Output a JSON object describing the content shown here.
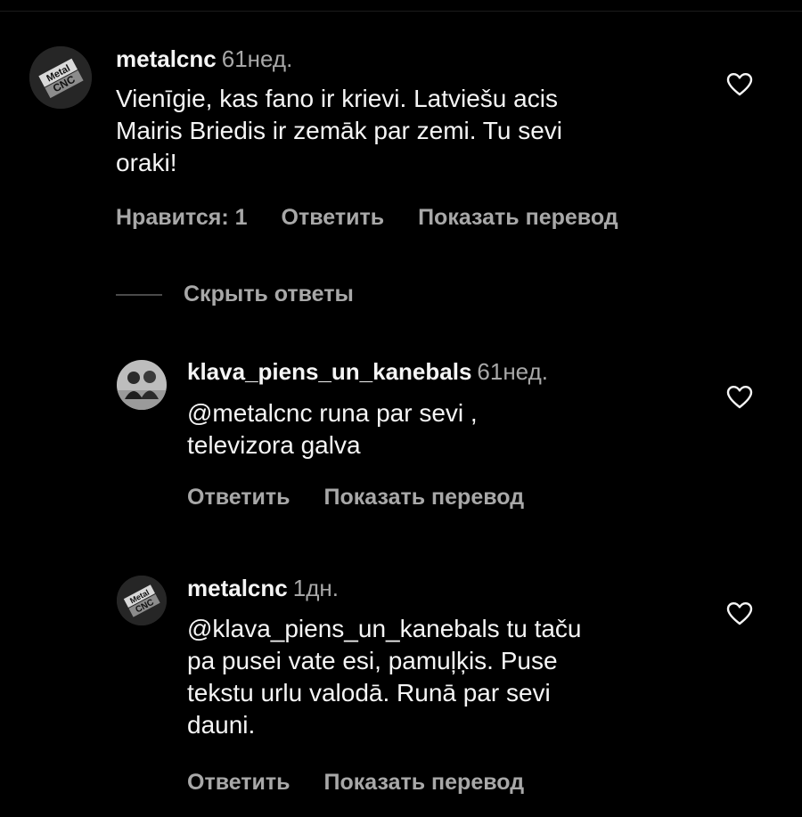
{
  "comments": [
    {
      "username": "metalcnc",
      "time": "61нед.",
      "text": "Vienīgie, kas fano ir krievi. Latviešu acis\nMairis Briedis ir zemāk par zemi. Tu sevi\noraki!",
      "likes_label": "Нравится: 1",
      "reply_label": "Ответить",
      "translate_label": "Показать перевод",
      "avatar_icon": "metal-cnc-logo"
    }
  ],
  "hide_replies_label": "Скрыть ответы",
  "replies": [
    {
      "username": "klava_piens_un_kanebals",
      "time": "61нед.",
      "text": "@metalcnc runa par sevi ,\ntelevizora galva",
      "reply_label": "Ответить",
      "translate_label": "Показать перевод",
      "avatar_icon": "two-people-photo"
    },
    {
      "username": "metalcnc",
      "time": "1дн.",
      "text": "@klava_piens_un_kanebals tu taču\npa pusei vate esi, pamuļķis. Puse\ntekstu urlu valodā. Runā par sevi\ndauni.",
      "reply_label": "Ответить",
      "translate_label": "Показать перевод",
      "avatar_icon": "metal-cnc-logo"
    }
  ],
  "colors": {
    "background": "#000000",
    "primary_text": "#f5f5f5",
    "secondary_text": "#a8a8a8"
  }
}
